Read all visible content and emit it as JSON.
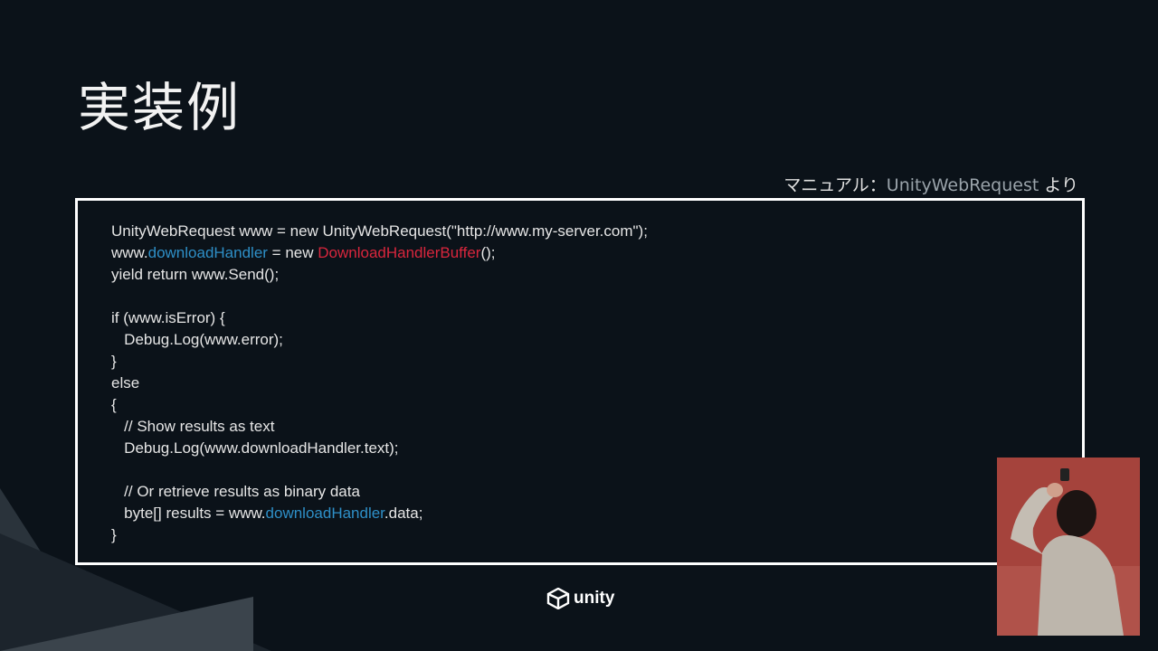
{
  "slide": {
    "title": "実装例",
    "source_prefix": "マニュアル：",
    "source_ref": "UnityWebRequest",
    "source_suffix": " より"
  },
  "code": {
    "l1": "UnityWebRequest www = new UnityWebRequest(\"http://www.my-server.com\");",
    "l2a": "www.",
    "l2b": "downloadHandler",
    "l2c": " = new ",
    "l2d": "DownloadHandlerBuffer",
    "l2e": "();",
    "l3": "yield return www.Send();",
    "l5": "if (www.isError) {",
    "l6": "   Debug.Log(www.error);",
    "l7": "}",
    "l8": "else",
    "l9": "{",
    "l10": "   // Show results as text",
    "l11": "   Debug.Log(www.downloadHandler.text);",
    "l13": "   // Or retrieve results as binary data",
    "l14a": "   byte[] results = www.",
    "l14b": "downloadHandler",
    "l14c": ".data;",
    "l15": "}"
  },
  "logo": {
    "text": "unity"
  },
  "colors": {
    "background": "#0b1219",
    "highlight_blue": "#2e8fc7",
    "highlight_red": "#d9263d"
  }
}
